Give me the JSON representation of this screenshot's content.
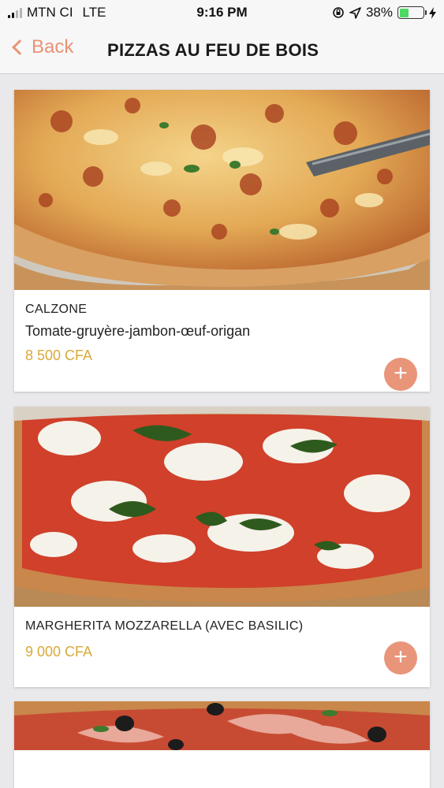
{
  "status_bar": {
    "carrier": "MTN CI",
    "network": "LTE",
    "time": "9:16 PM",
    "battery": "38%",
    "battery_level": 0.38,
    "battery_color": "#4cd964"
  },
  "nav": {
    "back_label": "Back",
    "title": "PIZZAS AU FEU DE BOIS",
    "accent_color": "#e89374"
  },
  "items": [
    {
      "name": "CALZONE",
      "description": "Tomate-gruyère-jambon-œuf-origan",
      "price": "8 500 CFA",
      "add_icon": "+"
    },
    {
      "name": "MARGHERITA MOZZARELLA (AVEC BASILIC)",
      "description": "",
      "price": "9 000 CFA",
      "add_icon": "+"
    }
  ],
  "colors": {
    "price": "#d9a93a",
    "add_button": "#e8957a"
  }
}
